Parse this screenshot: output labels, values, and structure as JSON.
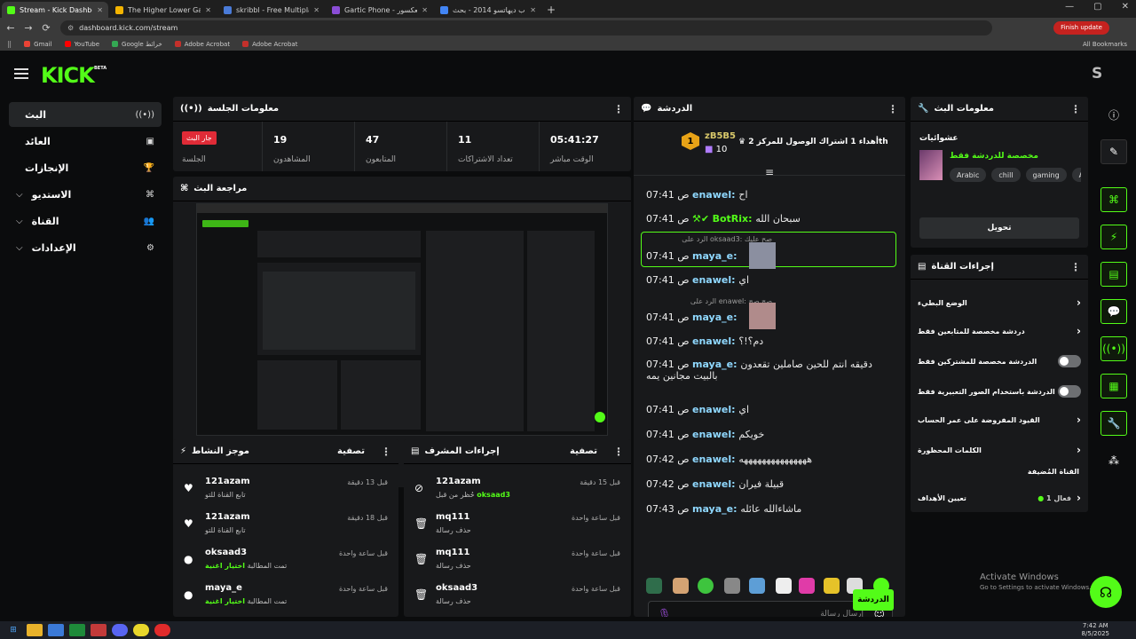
{
  "browser": {
    "tabs": [
      {
        "label": "Stream - Kick Dashboard",
        "color": "#53fc18",
        "active": true
      },
      {
        "label": "The Higher Lower Game",
        "color": "#f4b400",
        "active": false
      },
      {
        "label": "skribbl - Free Multiplayer Drawi",
        "color": "#4a7bd8",
        "active": false
      },
      {
        "label": "Gartic Phone - الهاتف العكسور",
        "color": "#8a4dd6",
        "active": false
      },
      {
        "label": "ذباب ديهاتسو 2014 - بحث Google",
        "color": "#4285f4",
        "active": false
      }
    ],
    "new_tab": "+",
    "url": "dashboard.kick.com/stream",
    "update_button": "Finish update",
    "bookmarks": [
      "Gmail",
      "YouTube",
      "Google خرائط",
      "Adobe Acrobat",
      "Adobe Acrobat"
    ],
    "all_bookmarks": "All Bookmarks"
  },
  "header": {
    "logo": "KICK",
    "beta": "BETA",
    "avatar_letter": "S"
  },
  "nav": [
    {
      "label": "البث",
      "icon": "((•))",
      "chevron": ""
    },
    {
      "label": "العائد",
      "icon": "▣",
      "chevron": ""
    },
    {
      "label": "الإنجازات",
      "icon": "🏆",
      "chevron": ""
    },
    {
      "label": "الاستديو",
      "icon": "⌘",
      "chevron": "⌵"
    },
    {
      "label": "القناة",
      "icon": "👥",
      "chevron": "⌵"
    },
    {
      "label": "الإعدادات",
      "icon": "⚙",
      "chevron": "⌵"
    }
  ],
  "session": {
    "title": "معلومات الجلسة",
    "live_badge": "جار البث",
    "session_label": "الجلسة",
    "stats": [
      {
        "value": "19",
        "label": "المشاهدون"
      },
      {
        "value": "47",
        "label": "المتابعون"
      },
      {
        "value": "11",
        "label": "تعداد الاشتراكات"
      },
      {
        "value": "05:41:27",
        "label": "الوقت مباشر"
      }
    ]
  },
  "preview": {
    "title": "مراجعة البث"
  },
  "activity": {
    "title": "موجز النشاط",
    "filter": "تصفية",
    "items": [
      {
        "icon": "♥",
        "user": "121azam",
        "desc": "تابع القناة للتو",
        "highlight": "",
        "time": "قبل 13 دقيقة"
      },
      {
        "icon": "♥",
        "user": "121azam",
        "desc": "تابع القناة للتو",
        "highlight": "",
        "time": "قبل 18 دقيقة"
      },
      {
        "icon": "●",
        "user": "oksaad3",
        "desc": "تمت المطالبة",
        "highlight": "اختيار اغنية",
        "time": "قبل ساعة واحدة"
      },
      {
        "icon": "●",
        "user": "maya_e",
        "desc": "تمت المطالبة",
        "highlight": "اختيار اغنية",
        "time": "قبل ساعة واحدة"
      }
    ]
  },
  "modactions": {
    "title": "إجراءات المشرف",
    "filter": "تصفية",
    "items": [
      {
        "icon": "⊘",
        "user": "121azam",
        "desc": "حُظر من قبل",
        "highlight": "oksaad3",
        "time": "قبل 15 دقيقة"
      },
      {
        "icon": "🗑",
        "user": "mq111",
        "desc": "حذف رسالة",
        "highlight": "",
        "time": "قبل ساعة واحدة"
      },
      {
        "icon": "🗑",
        "user": "mq111",
        "desc": "حذف رسالة",
        "highlight": "",
        "time": "قبل ساعة واحدة"
      },
      {
        "icon": "🗑",
        "user": "oksaad3",
        "desc": "حذف رسالة",
        "highlight": "",
        "time": "قبل ساعة واحدة"
      }
    ]
  },
  "chat": {
    "title": "الدردشة",
    "pinned_user": "zB5B5",
    "pinned_count": "10",
    "pinned_text": "أهداء 1 اشتراك الوصول للمركز 2",
    "pinned_suffix": "th",
    "messages": [
      {
        "time": "07:41 ص",
        "user": "enawel",
        "text": "اح",
        "bot": false
      },
      {
        "time": "07:41 ص",
        "user": "BotRix",
        "text": "سبحان الله",
        "bot": true
      },
      {
        "time": "07:41 ص",
        "user": "maya_e",
        "text": "",
        "bot": false
      },
      {
        "time": "07:41 ص",
        "user": "enawel",
        "text": "اي",
        "bot": false
      },
      {
        "time": "07:41 ص",
        "user": "maya_e",
        "text": "",
        "bot": false
      },
      {
        "time": "07:41 ص",
        "user": "enawel",
        "text": "دم؟!؟",
        "bot": false
      },
      {
        "time": "07:41 ص",
        "user": "maya_e",
        "text": "دقيقه انتم للحين صاملين تقعدون بالبيت مجانين يمه",
        "bot": false
      },
      {
        "time": "07:41 ص",
        "user": "enawel",
        "text": "اي",
        "bot": false
      },
      {
        "time": "07:41 ص",
        "user": "enawel",
        "text": "خويكم",
        "bot": false
      },
      {
        "time": "07:42 ص",
        "user": "enawel",
        "text": "هههههههههههههههه",
        "bot": false
      },
      {
        "time": "07:42 ص",
        "user": "enawel",
        "text": "قبيلة فيران",
        "bot": false
      },
      {
        "time": "07:43 ص",
        "user": "maya_e",
        "text": "ماشاءالله عائله",
        "bot": false
      }
    ],
    "reply1": "الرد على oksaad3: صح عليك",
    "reply2": "الرد على enawel: صح صح",
    "input_placeholder": "إرسال رسالة",
    "send_button": "الدردشة"
  },
  "streaminfo": {
    "title": "معلومات البث",
    "category": "عشوائيات",
    "subtitle": "مخصصة للدردشة فقط",
    "tags": [
      "Arabic",
      "chill",
      "gaming",
      "AR"
    ],
    "edit_button": "تحويل"
  },
  "channelactions": {
    "title": "إجراءات القناة",
    "rows": [
      {
        "label": "الوضع البطيء",
        "control": "chevron"
      },
      {
        "label": "دردشة مخصصة للمتابعين فقط",
        "control": "chevron"
      },
      {
        "label": "الدردشة مخصصة للمشتركين فقط",
        "control": "toggle"
      },
      {
        "label": "الدردشة باستخدام الصور التعبيرية فقط",
        "control": "toggle"
      },
      {
        "label": "القيود المفروضة على عمر الحساب",
        "control": "chevron"
      },
      {
        "label": "الكلمات المحظورة",
        "control": "chevron"
      }
    ],
    "hosted_label": "القناة المُضيفة",
    "goals_label": "تعيين الأهداف",
    "goals_status": "فعال 1"
  },
  "activation": {
    "line1": "Activate Windows",
    "line2": "Go to Settings to activate Windows."
  },
  "taskbar": {
    "time": "7:42 AM",
    "date": "8/5/2025"
  },
  "colors": {
    "accent": "#53fc18",
    "live": "#e02b37",
    "panel": "#18191b"
  }
}
